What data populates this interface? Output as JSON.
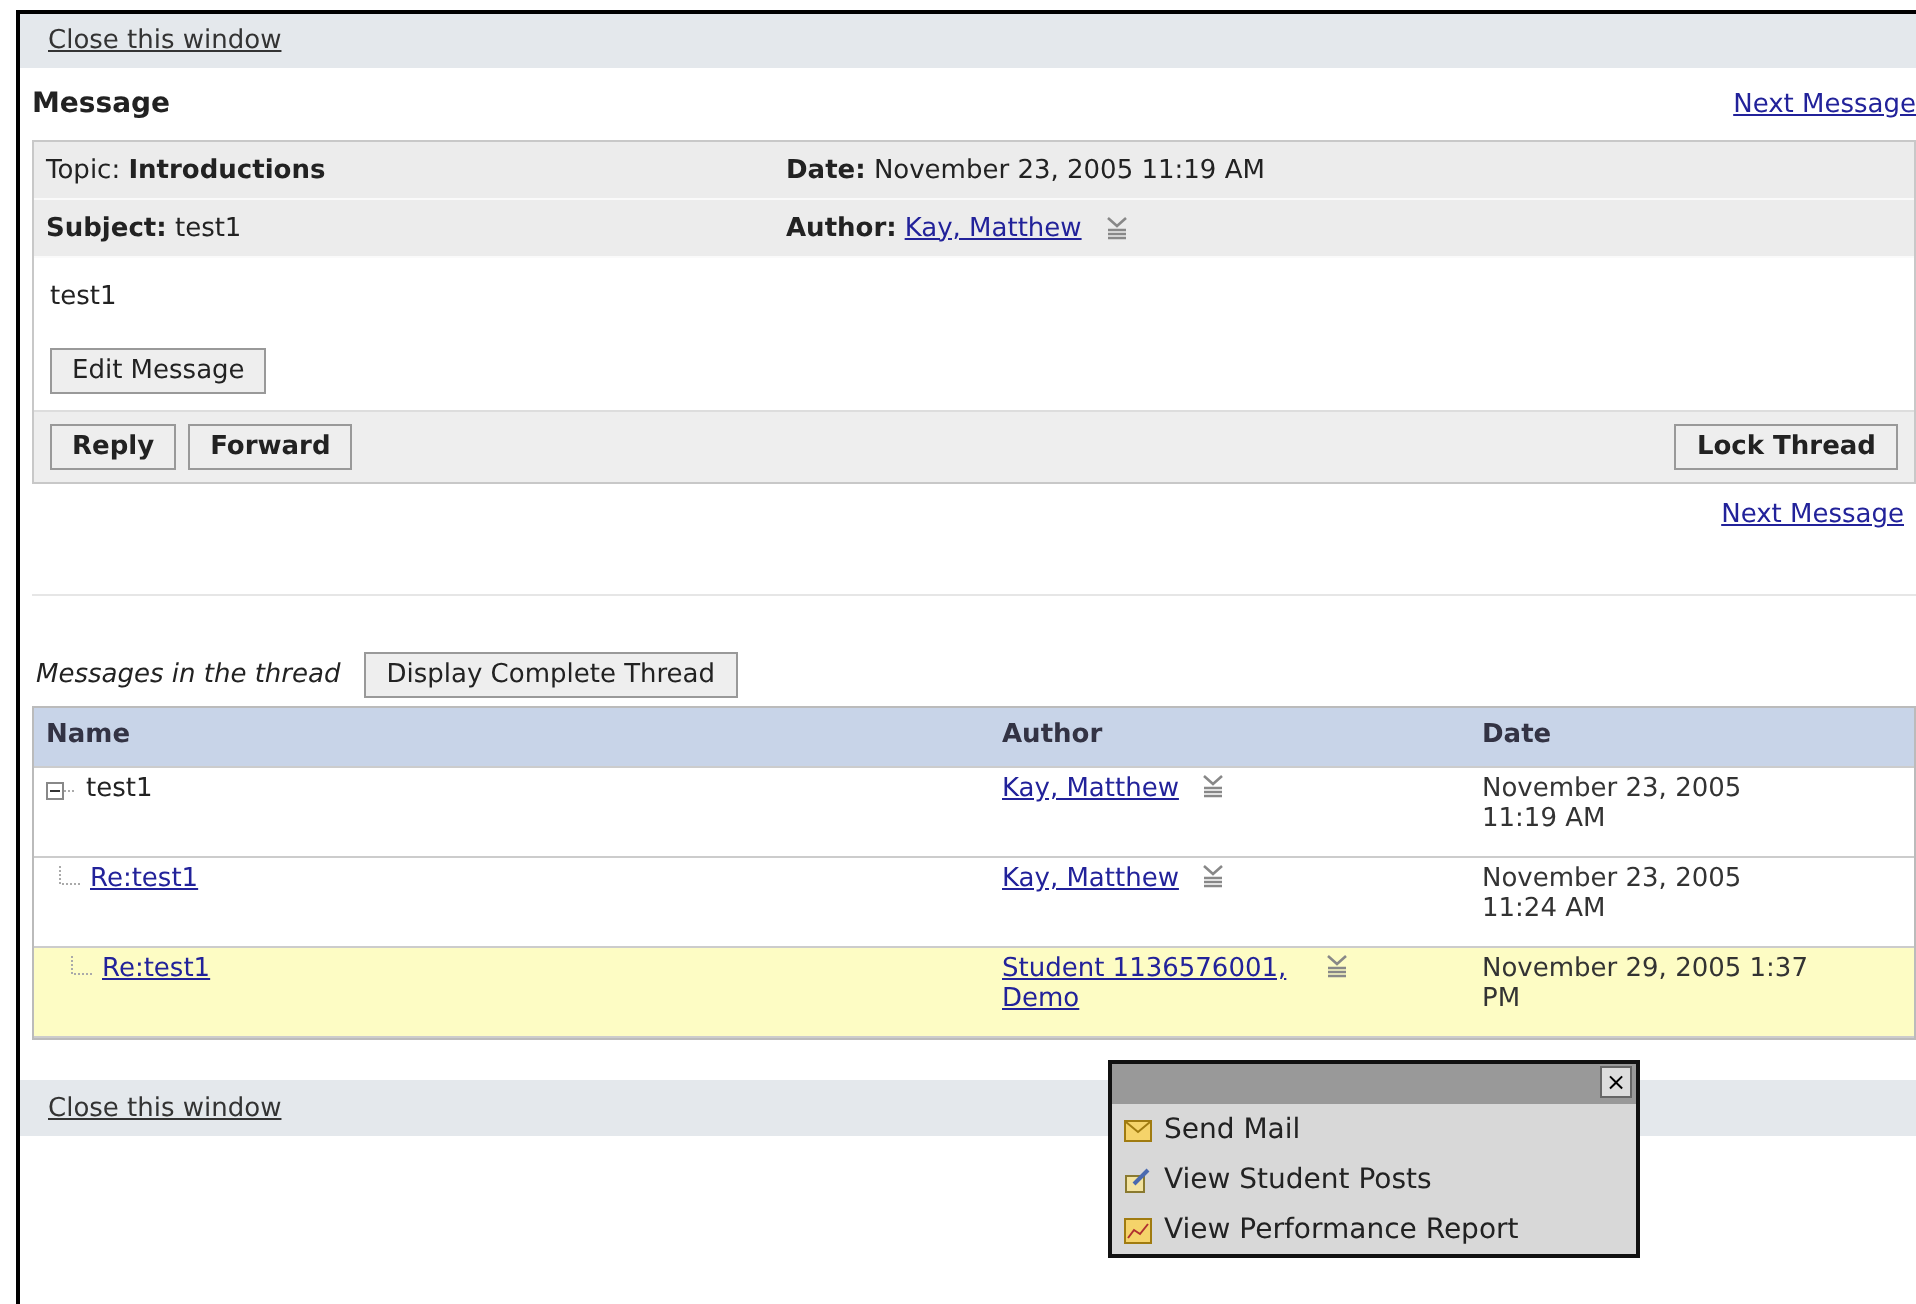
{
  "top_link": "Close this window",
  "message": {
    "title": "Message",
    "next_link": "Next Message",
    "topic_label": "Topic:",
    "topic": "Introductions",
    "date_label": "Date:",
    "date": "November 23, 2005 11:19 AM",
    "subject_label": "Subject:",
    "subject": "test1",
    "author_label": "Author:",
    "author": "Kay, Matthew",
    "body": "test1",
    "edit_button": "Edit Message",
    "actions": [
      "Reply",
      "Forward"
    ],
    "lock_button": "Lock Thread"
  },
  "bottom_next_link": "Next Message",
  "thread": {
    "label": "Messages in the thread",
    "display_button": "Display Complete Thread",
    "columns": [
      "Name",
      "Author",
      "Date"
    ],
    "rows": [
      {
        "name": "test1",
        "link": false,
        "expanded": true,
        "author": "Kay, Matthew",
        "date": "November 23, 2005 11:19 AM",
        "selected": false,
        "children": [
          {
            "name": "Re:test1",
            "link": true,
            "author": "Kay, Matthew",
            "date": "November 23, 2005 11:24 AM",
            "selected": false,
            "children": [
              {
                "name": "Re:test1",
                "link": true,
                "author": "Student 1136576001, Demo",
                "date": "November 29, 2005 1:37 PM",
                "selected": true,
                "menu_open": true
              }
            ]
          }
        ]
      }
    ]
  },
  "popup_menu": {
    "close": "×",
    "items": [
      {
        "kind": "mail",
        "label": "Send Mail"
      },
      {
        "kind": "posts",
        "label": "View Student Posts"
      },
      {
        "kind": "report",
        "label": "View Performance Report"
      }
    ]
  },
  "footer_link": "Close this window"
}
